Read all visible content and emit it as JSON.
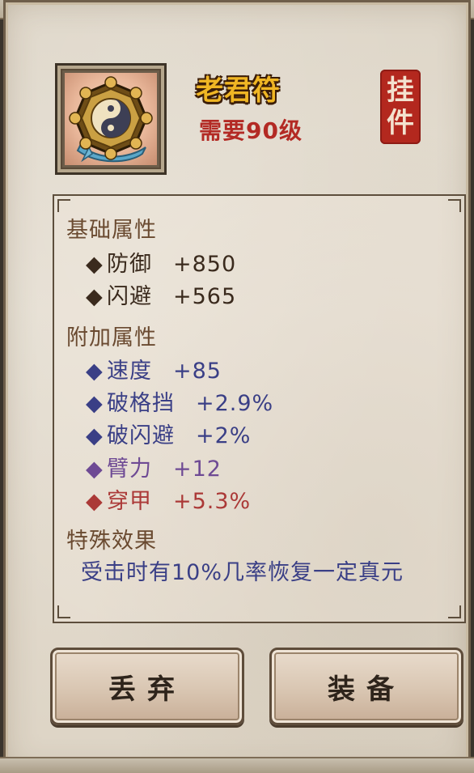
{
  "item": {
    "name": "老君符",
    "level_requirement": "需要90级",
    "stamp_char_1": "挂",
    "stamp_char_2": "件"
  },
  "sections": {
    "base_title": "基础属性",
    "extra_title": "附加属性",
    "special_title": "特殊效果"
  },
  "base_attrs": [
    {
      "name": "防御",
      "value": "+850"
    },
    {
      "name": "闪避",
      "value": "+565"
    }
  ],
  "extra_attrs": [
    {
      "name": "速度",
      "value": "+85"
    },
    {
      "name": "破格挡",
      "value": "+2.9%"
    },
    {
      "name": "破闪避",
      "value": "+2%"
    },
    {
      "name": "臂力",
      "value": "+12"
    },
    {
      "name": "穿甲",
      "value": "+5.3%"
    }
  ],
  "special_effect": "受击时有10%几率恢复一定真元",
  "buttons": {
    "discard": "丢弃",
    "equip": "装备"
  },
  "colors": {
    "name_gold": "#f0b624",
    "level_red": "#b32a24",
    "attr_dark": "#3a2a1d",
    "attr_blue": "#3a3f86",
    "attr_purple": "#6e4a94",
    "attr_red": "#ab3937"
  },
  "icons": {
    "item_icon": "bagua-talisman-icon",
    "diamond": "diamond-bullet-icon"
  }
}
